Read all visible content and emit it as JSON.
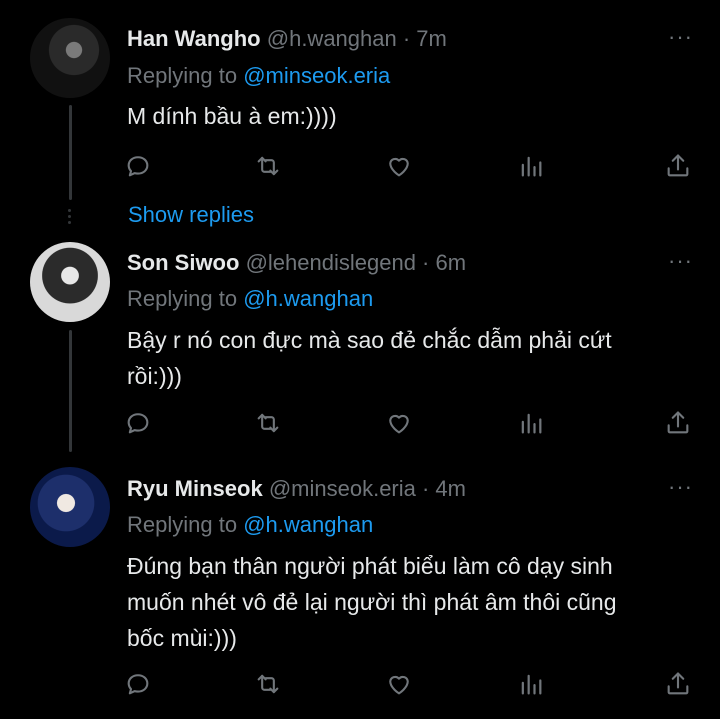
{
  "tweets": [
    {
      "name": "Han Wangho",
      "meta": "@h.wanghan · 7m",
      "replying_prefix": "Replying to",
      "replying_to": "@minseok.eria",
      "text": [
        "M dính bầu à em:))))"
      ]
    },
    {
      "name": "Son Siwoo",
      "meta": "@lehendislegend · 6m",
      "replying_prefix": "Replying to",
      "replying_to": "@h.wanghan",
      "text": [
        "Bậy r nó con đực mà sao đẻ chắc dẫm phải cứt",
        "rồi:)))"
      ]
    },
    {
      "name": "Ryu Minseok",
      "meta": "@minseok.eria · 4m",
      "replying_prefix": "Replying to",
      "replying_to": "@h.wanghan",
      "text": [
        "Đúng bạn thân người phát biểu làm cô dạy sinh",
        "muốn nhét vô đẻ lại người thì phát âm thôi cũng",
        "bốc mùi:)))"
      ]
    }
  ],
  "show_replies": "Show replies",
  "more_glyph": "···",
  "icons": [
    "reply-icon",
    "retweet-icon",
    "like-icon",
    "views-icon",
    "share-icon"
  ],
  "colors": {
    "link": "#1d9bf0",
    "muted": "#71767b",
    "text": "#e7e9ea",
    "background": "#000000"
  }
}
